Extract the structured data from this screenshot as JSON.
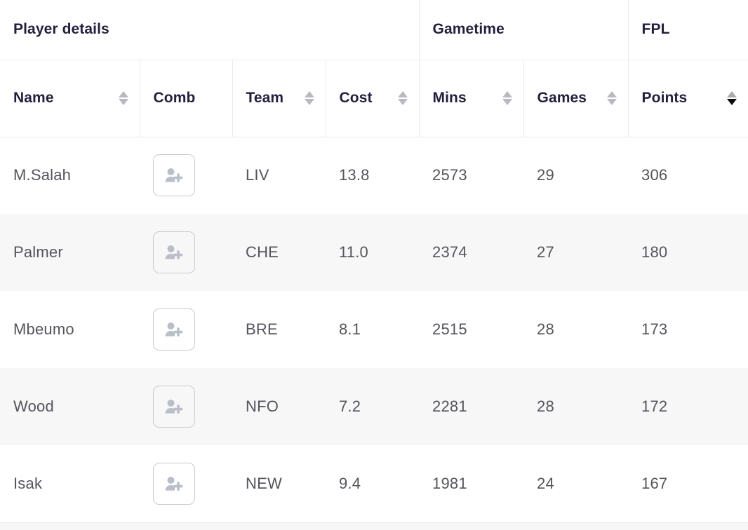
{
  "table": {
    "group_headers": [
      {
        "label": "Player details",
        "span": 4
      },
      {
        "label": "Gametime",
        "span": 2
      },
      {
        "label": "FPL",
        "span": 1
      }
    ],
    "columns": [
      {
        "key": "name",
        "label": "Name",
        "sortable": true,
        "sort_state": "none"
      },
      {
        "key": "comb",
        "label": "Comb",
        "sortable": false,
        "sort_state": "none"
      },
      {
        "key": "team",
        "label": "Team",
        "sortable": true,
        "sort_state": "none"
      },
      {
        "key": "cost",
        "label": "Cost",
        "sortable": true,
        "sort_state": "none"
      },
      {
        "key": "mins",
        "label": "Mins",
        "sortable": true,
        "sort_state": "none"
      },
      {
        "key": "games",
        "label": "Games",
        "sortable": true,
        "sort_state": "none"
      },
      {
        "key": "points",
        "label": "Points",
        "sortable": true,
        "sort_state": "desc"
      }
    ],
    "rows": [
      {
        "name": "M.Salah",
        "comb_icon": "add-user-icon",
        "team": "LIV",
        "cost": "13.8",
        "mins": "2573",
        "games": "29",
        "points": "306"
      },
      {
        "name": "Palmer",
        "comb_icon": "add-user-icon",
        "team": "CHE",
        "cost": "11.0",
        "mins": "2374",
        "games": "27",
        "points": "180"
      },
      {
        "name": "Mbeumo",
        "comb_icon": "add-user-icon",
        "team": "BRE",
        "cost": "8.1",
        "mins": "2515",
        "games": "28",
        "points": "173"
      },
      {
        "name": "Wood",
        "comb_icon": "add-user-icon",
        "team": "NFO",
        "cost": "7.2",
        "mins": "2281",
        "games": "28",
        "points": "172"
      },
      {
        "name": "Isak",
        "comb_icon": "add-user-icon",
        "team": "NEW",
        "cost": "9.4",
        "mins": "1981",
        "games": "24",
        "points": "167"
      }
    ]
  },
  "colors": {
    "header_text": "#231f3d",
    "body_text": "#55545c",
    "border": "#e9eaee",
    "stripe": "#f7f7f8",
    "icon_gray": "#b9bfc9",
    "sort_inactive": "#b9b9bf",
    "sort_active": "#0b0b0b",
    "button_border": "#c9cbd2"
  }
}
